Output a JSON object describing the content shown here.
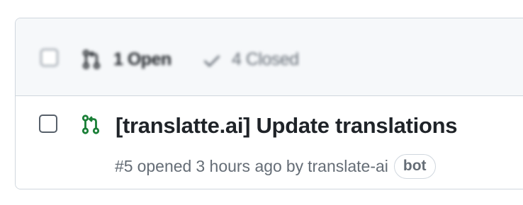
{
  "header": {
    "open_count_label": "1 Open",
    "closed_count_label": "4 Closed",
    "icons": {
      "pull_request": "git-pull-request-icon",
      "closed": "check-icon"
    }
  },
  "pull_requests": [
    {
      "title": "[translatte.ai] Update translations",
      "number": "#5",
      "opened_text": "opened",
      "time": "3 hours ago",
      "by_text": "by",
      "author": "translate-ai",
      "badge": "bot",
      "state_color": "#1a7f37"
    }
  ],
  "colors": {
    "open_green": "#1a7f37",
    "border": "#d0d7de",
    "header_bg": "#f6f8fa",
    "muted_text": "#656d76",
    "primary_text": "#1f2328"
  }
}
